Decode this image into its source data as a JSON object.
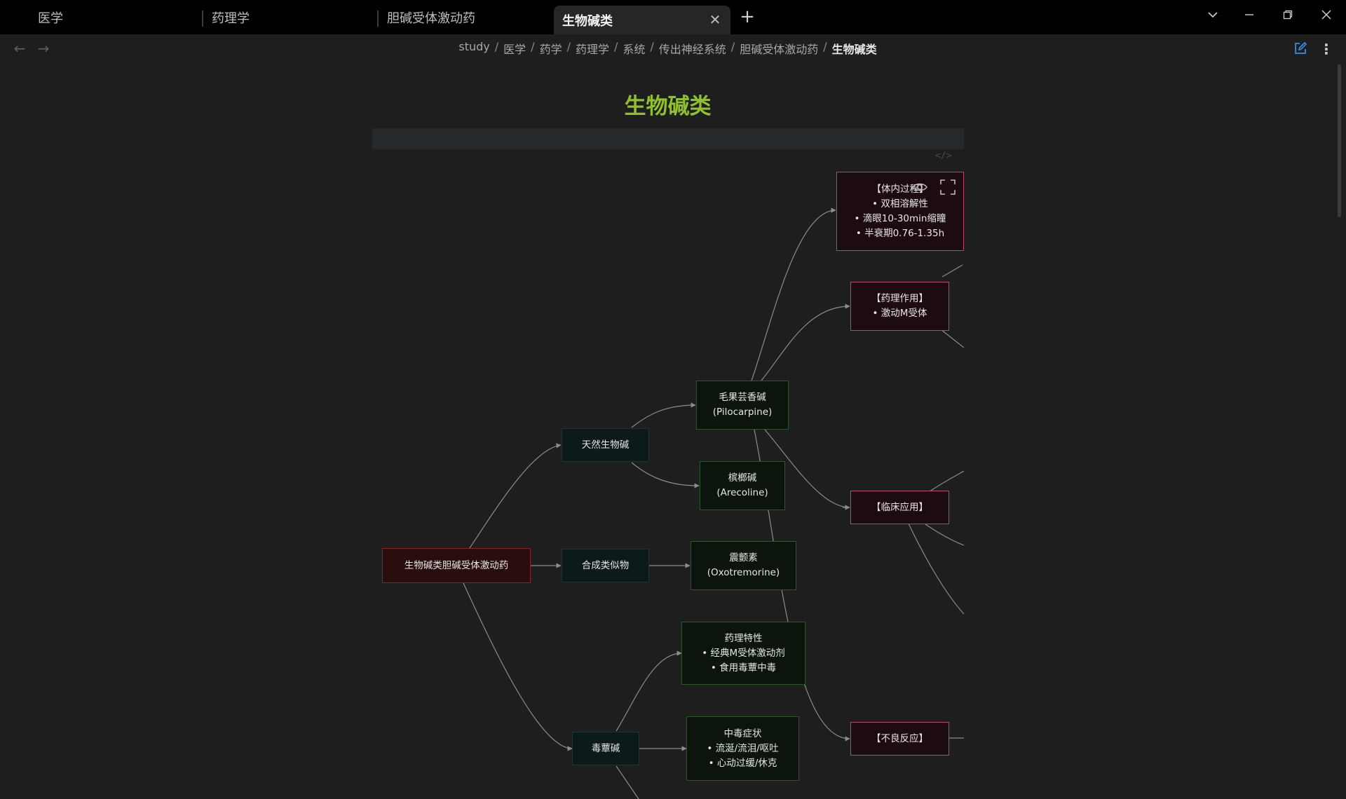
{
  "tabs": [
    {
      "label": "医学"
    },
    {
      "label": "药理学"
    },
    {
      "label": "胆碱受体激动药"
    },
    {
      "label": "生物碱类",
      "active": true
    }
  ],
  "tabbar": {
    "new_tab_icon": "plus-icon",
    "close_icon": "close-icon"
  },
  "window_controls": [
    "chevron-down-icon",
    "minimize-icon",
    "restore-icon",
    "close-icon"
  ],
  "nav": {
    "back_icon": "arrow-left-icon",
    "forward_icon": "arrow-right-icon"
  },
  "breadcrumb": [
    "study",
    "医学",
    "药学",
    "药理学",
    "系统",
    "传出神经系统",
    "胆碱受体激动药",
    "生物碱类"
  ],
  "header_actions": {
    "edit_icon": "edit-icon",
    "more_icon": "more-vertical-icon"
  },
  "page": {
    "title": "生物碱类",
    "code_tag": "</>"
  },
  "mindmap": {
    "root": "生物碱类胆碱受体激动药",
    "natural": "天然生物碱",
    "synthetic": "合成类似物",
    "muscarine": "毒蕈碱",
    "pilocarpine": {
      "name": "毛果芸香碱",
      "en": "(Pilocarpine)"
    },
    "arecoline": {
      "name": "槟榔碱",
      "en": "(Arecoline)"
    },
    "oxotremorine": {
      "name": "震颤素",
      "en": "(Oxotremorine)"
    },
    "pharm_props": {
      "title": "药理特性",
      "items": [
        "• 经典M受体激动剂",
        "• 食用毒蕈中毒"
      ]
    },
    "poisoning": {
      "title": "中毒症状",
      "items": [
        "• 流涎/流泪/呕吐",
        "• 心动过缓/休克"
      ]
    },
    "in_vivo": {
      "title": "【体内过程】",
      "items": [
        "• 双相溶解性",
        "• 滴眼10-30min缩瞳",
        "• 半衰期0.76-1.35h"
      ]
    },
    "pharm_action": {
      "title": "【药理作用】",
      "items": [
        "• 激动M受体"
      ]
    },
    "clinical": {
      "title": "【临床应用】"
    },
    "adverse": {
      "title": "【不良反应】"
    }
  },
  "colors": {
    "title": "#8fc02e",
    "accent_edit": "#3b8eea",
    "root_border": "#8b2323",
    "leaf_border": "#b8466f",
    "green_border": "#2c552c"
  }
}
